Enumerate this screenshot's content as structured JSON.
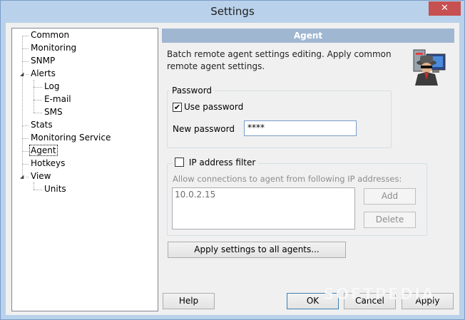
{
  "window": {
    "title": "Settings",
    "close_glyph": "✕"
  },
  "tree": {
    "items": [
      {
        "label": "Common"
      },
      {
        "label": "Monitoring"
      },
      {
        "label": "SNMP"
      },
      {
        "label": "Alerts"
      },
      {
        "label": "Log"
      },
      {
        "label": "E-mail"
      },
      {
        "label": "SMS"
      },
      {
        "label": "Stats"
      },
      {
        "label": "Monitoring Service"
      },
      {
        "label": "Agent"
      },
      {
        "label": "Hotkeys"
      },
      {
        "label": "View"
      },
      {
        "label": "Units"
      }
    ],
    "selected": "Agent"
  },
  "panel": {
    "header": "Agent",
    "description": "Batch remote agent settings editing. Apply common remote agent settings.",
    "icon": "agent-spy-computer-icon"
  },
  "password_group": {
    "title": "Password",
    "use_password_label": "Use password",
    "use_password_checked": true,
    "new_password_label": "New password",
    "new_password_value": "****"
  },
  "ip_filter_group": {
    "title": "IP address filter",
    "checked": false,
    "hint": "Allow connections to agent from following IP addresses:",
    "entries": [
      "10.0.2.15"
    ],
    "add_label": "Add",
    "delete_label": "Delete"
  },
  "apply_all_label": "Apply settings to all agents...",
  "footer": {
    "help_label": "Help",
    "ok_label": "OK",
    "cancel_label": "Cancel",
    "apply_label": "Apply"
  },
  "watermark": "SOFTPEDIA"
}
